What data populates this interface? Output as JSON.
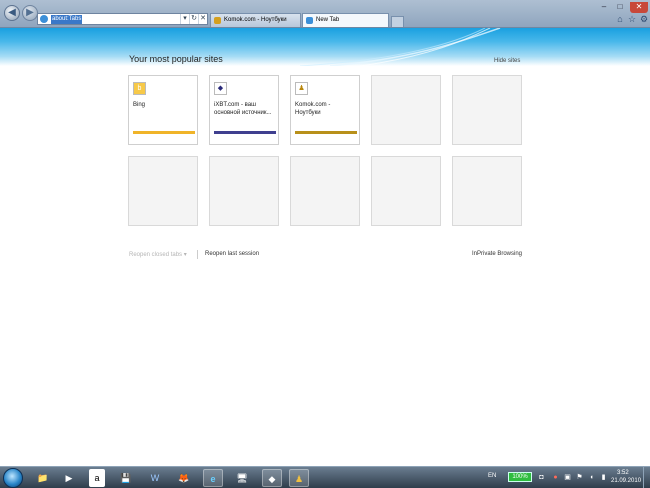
{
  "browser": {
    "address": {
      "url": "about:Tabs"
    },
    "nav": {
      "back_icon": "◀",
      "forward_icon": "▶"
    },
    "address_buttons": [
      "▾",
      "↻",
      "✕"
    ],
    "tabs": [
      {
        "label": "Komok.com - Ноутбуки",
        "active": false
      },
      {
        "label": "New Tab",
        "active": true
      }
    ],
    "window_buttons": [
      "–",
      "□",
      "✕"
    ],
    "toolbar_icons": [
      "⌂",
      "☆",
      "⚙"
    ]
  },
  "page": {
    "heading": "Your most popular sites",
    "hide_sites": "Hide sites",
    "tiles": [
      {
        "label": "Bing",
        "icon": "b",
        "icon_color": "#e8a317",
        "bar_color": "#f0b429"
      },
      {
        "label": "iXBT.com - ваш основной источник...",
        "icon": "◆",
        "icon_color": "#2a2a7a",
        "bar_color": "#3f3f8f"
      },
      {
        "label": "Komok.com - Ноутбуки",
        "icon": "♟",
        "icon_color": "#b8860b",
        "bar_color": "#b8901a"
      }
    ],
    "reopen_closed": "Reopen closed tabs ▾",
    "reopen_session": "Reopen last session",
    "inprivate": "InPrivate Browsing"
  },
  "taskbar": {
    "language": "EN",
    "battery": "100%",
    "time": "3:52",
    "date": "21.09.2010",
    "items": [
      {
        "name": "explorer",
        "icon": "📁",
        "active": false
      },
      {
        "name": "media-player",
        "icon": "▶",
        "active": false
      },
      {
        "name": "amazon",
        "icon": "a",
        "active": false
      },
      {
        "name": "floppy",
        "icon": "💾",
        "active": false
      },
      {
        "name": "word",
        "icon": "W",
        "active": false
      },
      {
        "name": "firefox",
        "icon": "🦊",
        "active": false
      },
      {
        "name": "internet-explorer",
        "icon": "e",
        "active": true
      },
      {
        "name": "monitor",
        "icon": "🖥",
        "active": false
      },
      {
        "name": "ixbt",
        "icon": "◆",
        "active": true
      },
      {
        "name": "komok",
        "icon": "♟",
        "active": true
      }
    ]
  }
}
